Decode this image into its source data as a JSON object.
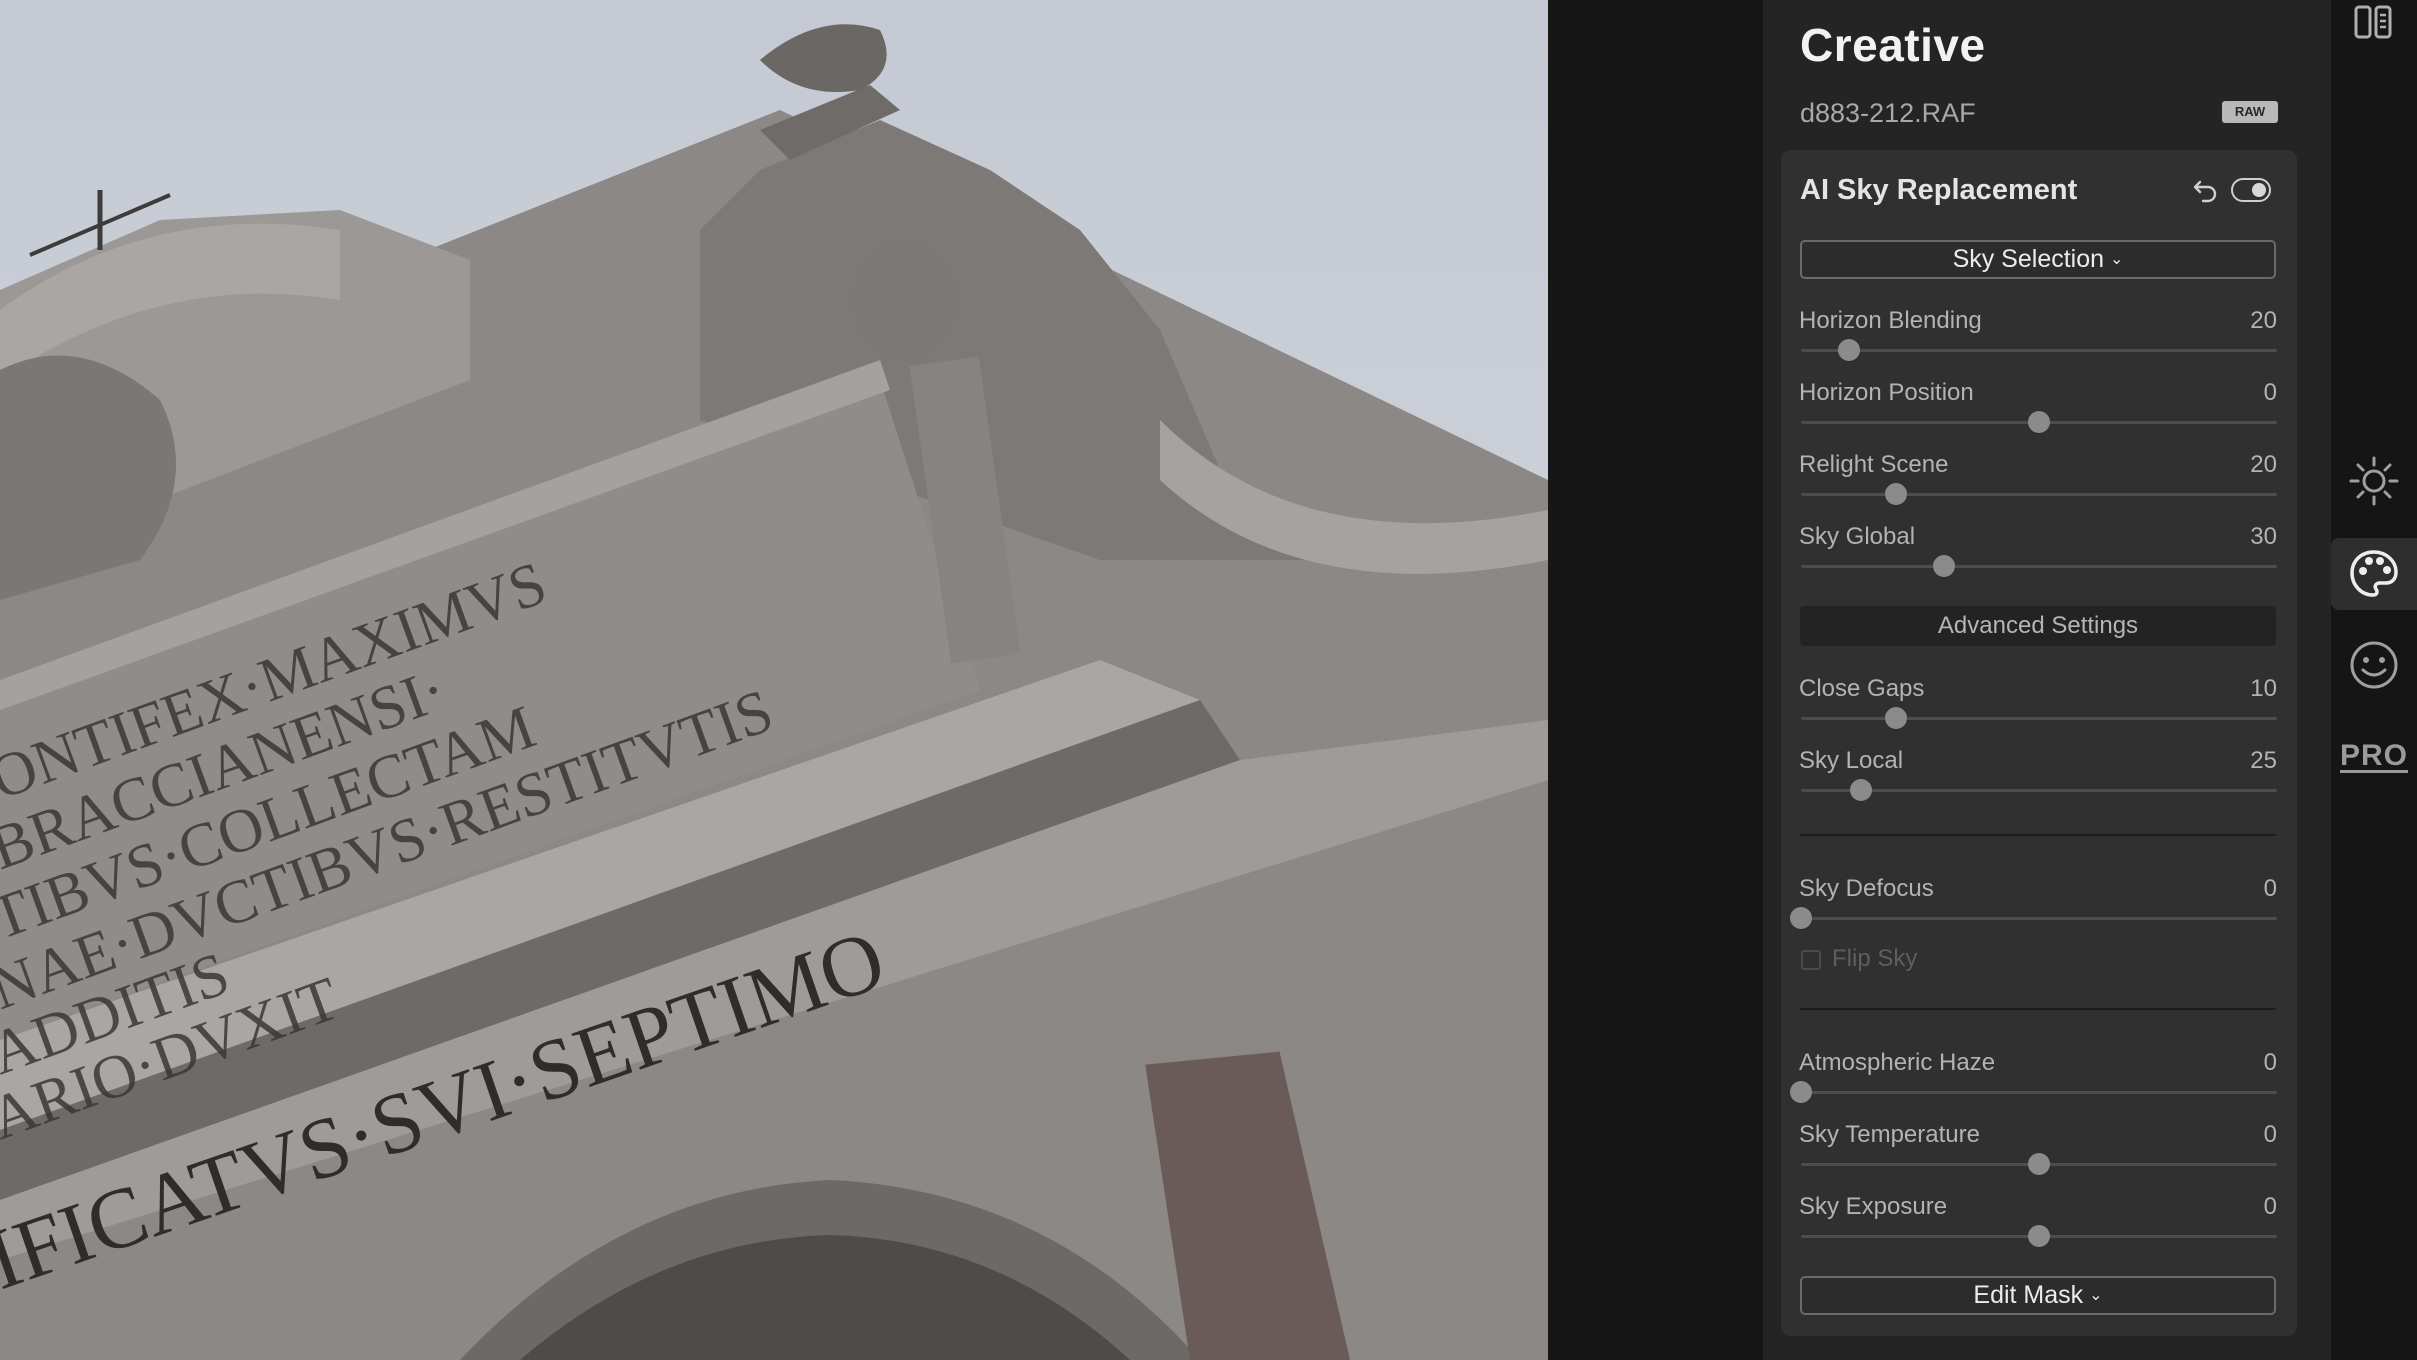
{
  "canvas": {
    "description_icon": "photo-canvas"
  },
  "panel": {
    "title": "Creative",
    "file_name": "d883-212.RAF",
    "file_badge": "RAW"
  },
  "tool": {
    "title": "AI Sky Replacement",
    "icons": {
      "reset": "undo-icon",
      "toggle": "toggle-switch-icon"
    },
    "sky_selection_label": "Sky Selection",
    "sliders_main": [
      {
        "label": "Horizon Blending",
        "value": "20",
        "fraction": 0.1
      },
      {
        "label": "Horizon Position",
        "value": "0",
        "fraction": 0.5
      },
      {
        "label": "Relight Scene",
        "value": "20",
        "fraction": 0.2
      },
      {
        "label": "Sky Global",
        "value": "30",
        "fraction": 0.3
      }
    ],
    "advanced_label": "Advanced Settings",
    "sliders_advanced": [
      {
        "label": "Close Gaps",
        "value": "10",
        "fraction": 0.2
      },
      {
        "label": "Sky Local",
        "value": "25",
        "fraction": 0.125
      }
    ],
    "sky_defocus": {
      "label": "Sky Defocus",
      "value": "0",
      "fraction": 0.0
    },
    "flip_sky_label": "Flip Sky",
    "sliders_tone": [
      {
        "label": "Atmospheric Haze",
        "value": "0",
        "fraction": 0.0
      },
      {
        "label": "Sky Temperature",
        "value": "0",
        "fraction": 0.5
      },
      {
        "label": "Sky Exposure",
        "value": "0",
        "fraction": 0.5
      }
    ],
    "edit_mask_label": "Edit Mask"
  },
  "rail": {
    "items": [
      {
        "icon": "compare-panels-icon",
        "active": false
      },
      {
        "icon": "sun-icon",
        "active": false
      },
      {
        "icon": "palette-icon",
        "active": true
      },
      {
        "icon": "smiley-face-icon",
        "active": false
      },
      {
        "icon": "pro-icon",
        "label": "PRO",
        "active": false
      }
    ]
  }
}
